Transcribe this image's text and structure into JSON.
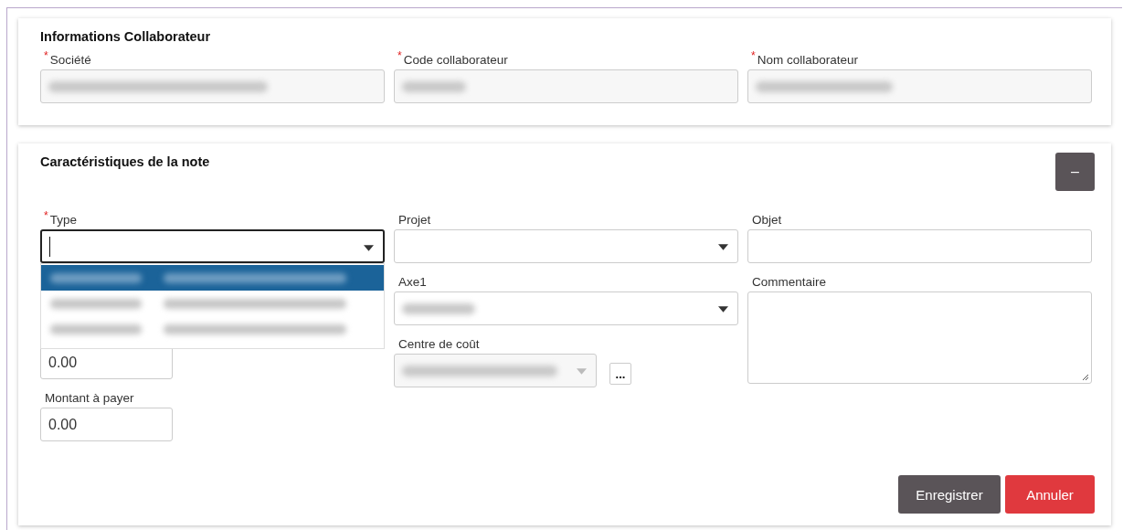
{
  "collaborateur": {
    "title": "Informations Collaborateur",
    "fields": [
      {
        "label": "Société",
        "required_mark": "*",
        "blurred": true
      },
      {
        "label": "Code collaborateur",
        "required_mark": "*",
        "blurred": true
      },
      {
        "label": "Nom collaborateur",
        "required_mark": "*",
        "blurred": true
      }
    ]
  },
  "note": {
    "title": "Caractéristiques de la note",
    "collapse_button": "–",
    "type_field": {
      "label": "Type",
      "required_mark": "*",
      "focused": true,
      "options": [
        {
          "selected": true
        },
        {
          "selected": false
        },
        {
          "selected": false
        }
      ]
    },
    "amount_field": {
      "value": "0.00"
    },
    "payable_field": {
      "label": "Montant à payer",
      "value": "0.00"
    },
    "projet_field": {
      "label": "Projet"
    },
    "axe_field": {
      "label": "Axe1",
      "blurred": true
    },
    "cost_center_field": {
      "label": "Centre de coût",
      "blurred": true,
      "disabled": true
    },
    "more_button": "...",
    "objet_field": {
      "label": "Objet"
    },
    "comment_field": {
      "label": "Commentaire"
    },
    "buttons": [
      {
        "label": "Enregistrer",
        "kind": "primary"
      },
      {
        "label": "Annuler",
        "kind": "danger"
      }
    ]
  }
}
